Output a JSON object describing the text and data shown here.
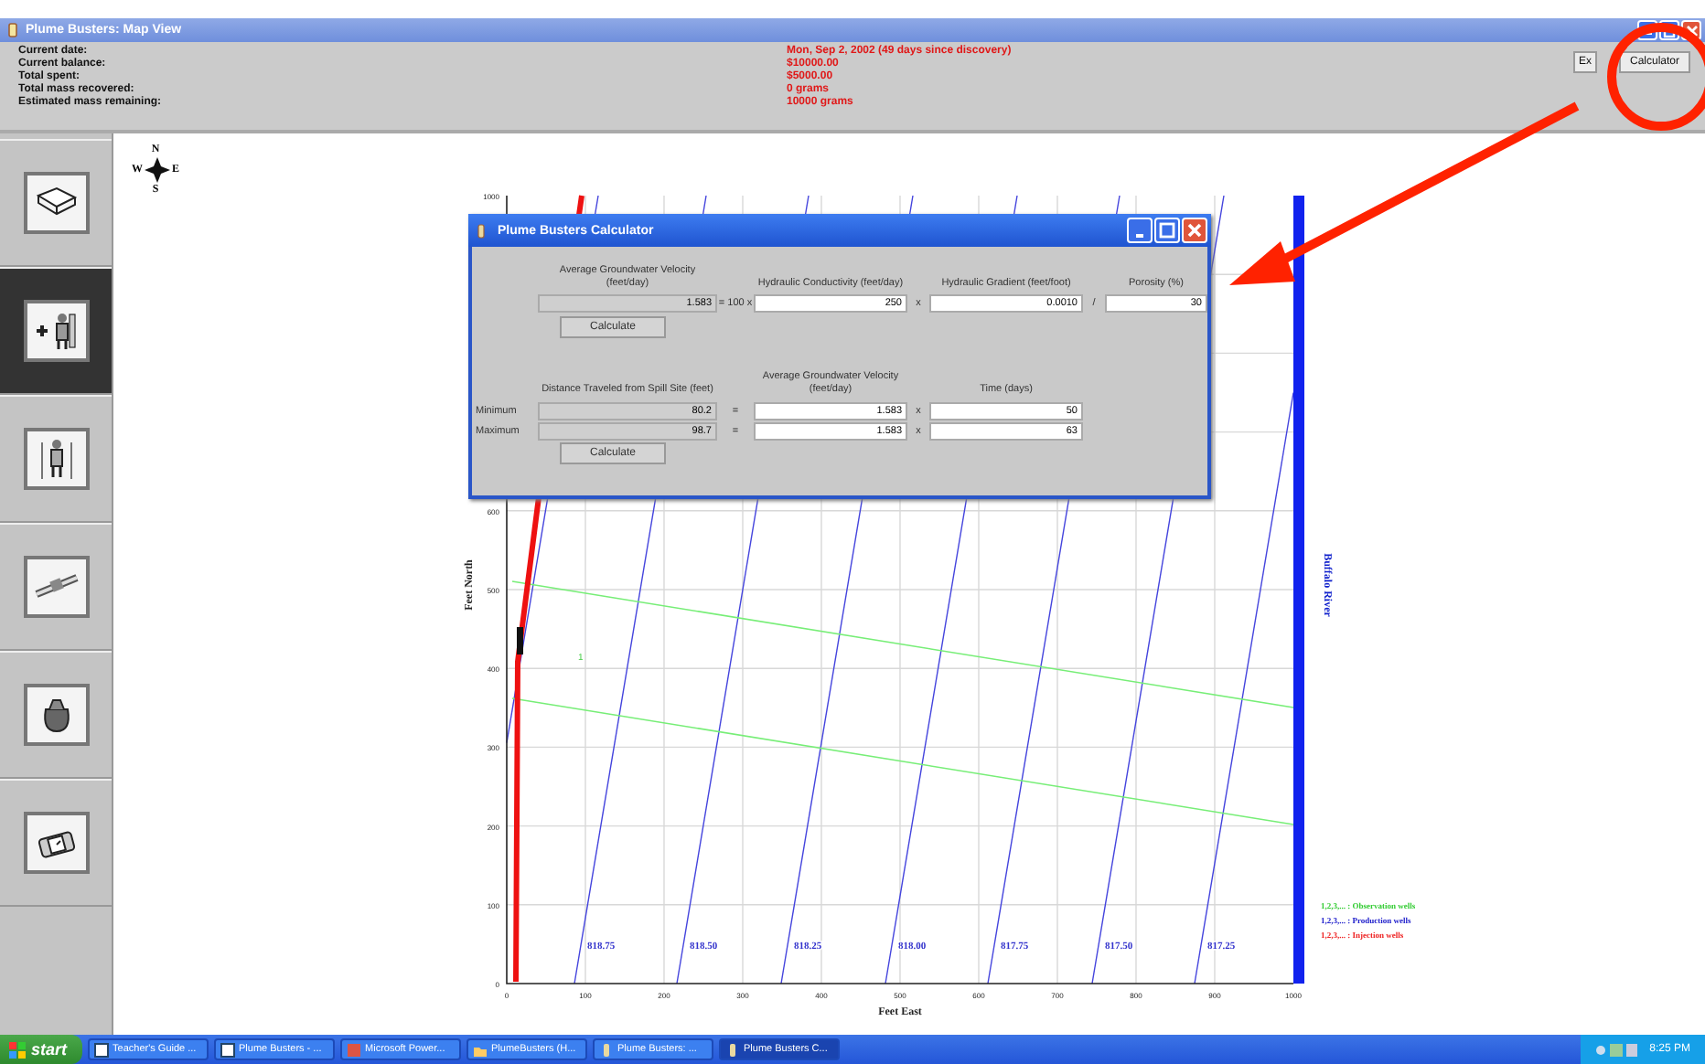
{
  "window": {
    "title": "Plume Busters: Map View"
  },
  "status": [
    {
      "label": "Current date:",
      "value": "Mon, Sep 2, 2002 (49 days since discovery)"
    },
    {
      "label": "Current balance:",
      "value": "$10000.00"
    },
    {
      "label": "Total spent:",
      "value": "$5000.00"
    },
    {
      "label": "Total mass recovered:",
      "value": "0 grams"
    },
    {
      "label": "Estimated mass remaining:",
      "value": "10000 grams"
    }
  ],
  "toolbar_buttons": [
    "Ex",
    "Calculator"
  ],
  "sidebar": {
    "items": [
      {
        "selected": false
      },
      {
        "selected": true
      },
      {
        "selected": false
      },
      {
        "selected": false
      },
      {
        "selected": false
      },
      {
        "selected": false
      }
    ]
  },
  "compass": {
    "north": "N",
    "south": "S",
    "west": "W",
    "east": "E"
  },
  "map": {
    "xlabel": "Feet East",
    "ylabel": "Feet North",
    "xticks": [
      "0",
      "100",
      "200",
      "300",
      "400",
      "500",
      "600",
      "700",
      "800",
      "900",
      "1000"
    ],
    "yticks": [
      "1000",
      "600",
      "500",
      "400",
      "300",
      "200",
      "100",
      "0"
    ],
    "contour_labels": [
      "818.75",
      "818.50",
      "818.25",
      "818.00",
      "817.75",
      "817.50",
      "817.25"
    ],
    "well_labels": [
      "1"
    ],
    "river_label": "Buffalo River",
    "legend": [
      {
        "text": "1,2,3,... : Observation wells",
        "color": "#33cc33"
      },
      {
        "text": "1,2,3,... : Production wells",
        "color": "#2222cc"
      },
      {
        "text": "1,2,3,... : Injection wells",
        "color": "#ee2222"
      }
    ]
  },
  "calculator": {
    "title": "Plume Busters Calculator",
    "velocity": {
      "headers": [
        "Average Groundwater Velocity (feet/day)",
        "Hydraulic Conductivity (feet/day)",
        "Hydraulic Gradient (feet/foot)",
        "Porosity (%)"
      ],
      "result": "1.583",
      "operators": [
        "= 100 x",
        "x",
        "/"
      ],
      "inputs": [
        "250",
        "0.0010",
        "30"
      ],
      "button": "Calculate"
    },
    "distance": {
      "headers": [
        "Distance Traveled from Spill Site (feet)",
        "Average Groundwater Velocity (feet/day)",
        "Time (days)"
      ],
      "rows": [
        {
          "label": "Minimum",
          "result": "80.2",
          "operators": [
            "=",
            "x"
          ],
          "inputs": [
            "1.583",
            "50"
          ]
        },
        {
          "label": "Maximum",
          "result": "98.7",
          "operators": [
            "=",
            "x"
          ],
          "inputs": [
            "1.583",
            "63"
          ]
        }
      ],
      "button": "Calculate"
    }
  },
  "taskbar": {
    "start": "start",
    "tasks": [
      {
        "label": "Teacher's Guide ...",
        "selected": false
      },
      {
        "label": "Plume Busters - ...",
        "selected": false
      },
      {
        "label": "Microsoft Power...",
        "selected": false
      },
      {
        "label": "PlumeBusters (H...",
        "selected": false
      },
      {
        "label": "Plume Busters: ...",
        "selected": false
      },
      {
        "label": "Plume Busters C...",
        "selected": true
      }
    ],
    "clock": "8:25 PM"
  }
}
